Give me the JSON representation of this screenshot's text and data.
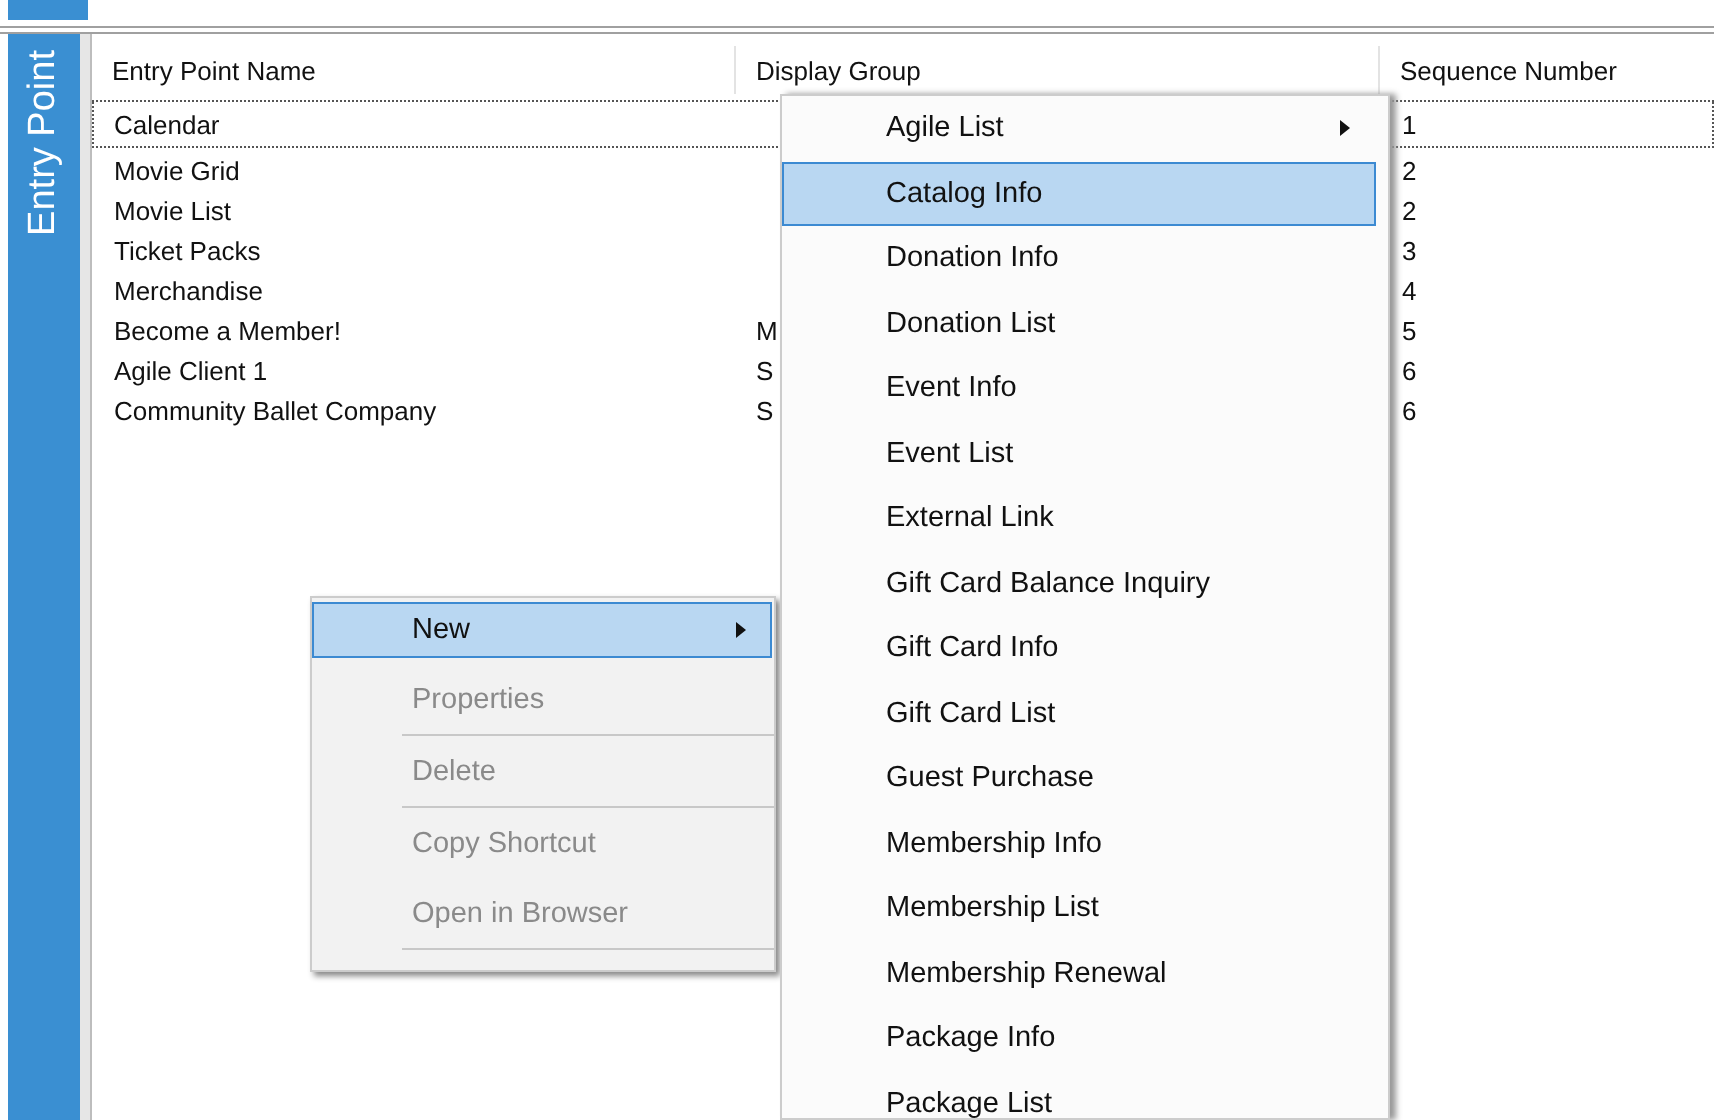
{
  "sidebar": {
    "title": "Entry Point"
  },
  "table": {
    "columns": [
      "Entry Point Name",
      "Display Group",
      "Sequence Number"
    ],
    "rows": [
      {
        "name": "Calendar",
        "display_group": "",
        "sequence": "1",
        "focused": true
      },
      {
        "name": "Movie Grid",
        "display_group": "",
        "sequence": "2",
        "focused": false
      },
      {
        "name": "Movie List",
        "display_group": "",
        "sequence": "2",
        "focused": false
      },
      {
        "name": "Ticket Packs",
        "display_group": "",
        "sequence": "3",
        "focused": false
      },
      {
        "name": "Merchandise",
        "display_group": "",
        "sequence": "4",
        "focused": false
      },
      {
        "name": "Become a Member!",
        "display_group": "M",
        "sequence": "5",
        "focused": false
      },
      {
        "name": "Agile Client 1",
        "display_group": "S",
        "sequence": "6",
        "focused": false
      },
      {
        "name": "Community Ballet Company",
        "display_group": "S",
        "sequence": "6",
        "focused": false
      }
    ]
  },
  "context_menu": {
    "items": [
      {
        "kind": "item",
        "label": "New",
        "selected": true,
        "disabled": false,
        "submenu": true
      },
      {
        "kind": "item",
        "label": "Properties",
        "selected": false,
        "disabled": true,
        "submenu": false
      },
      {
        "kind": "separator"
      },
      {
        "kind": "item",
        "label": "Delete",
        "selected": false,
        "disabled": true,
        "submenu": false
      },
      {
        "kind": "separator"
      },
      {
        "kind": "item",
        "label": "Copy Shortcut",
        "selected": false,
        "disabled": true,
        "submenu": false
      },
      {
        "kind": "item",
        "label": "Open in Browser",
        "selected": false,
        "disabled": true,
        "submenu": false
      },
      {
        "kind": "separator"
      }
    ]
  },
  "submenu": {
    "items": [
      {
        "label": "Agile List",
        "selected": false,
        "submenu": true
      },
      {
        "label": "Catalog Info",
        "selected": true,
        "submenu": false
      },
      {
        "label": "Donation Info",
        "selected": false,
        "submenu": false
      },
      {
        "label": "Donation List",
        "selected": false,
        "submenu": false
      },
      {
        "label": "Event Info",
        "selected": false,
        "submenu": false
      },
      {
        "label": "Event List",
        "selected": false,
        "submenu": false
      },
      {
        "label": "External Link",
        "selected": false,
        "submenu": false
      },
      {
        "label": "Gift Card Balance Inquiry",
        "selected": false,
        "submenu": false
      },
      {
        "label": "Gift Card Info",
        "selected": false,
        "submenu": false
      },
      {
        "label": "Gift Card List",
        "selected": false,
        "submenu": false
      },
      {
        "label": "Guest Purchase",
        "selected": false,
        "submenu": false
      },
      {
        "label": "Membership Info",
        "selected": false,
        "submenu": false
      },
      {
        "label": "Membership List",
        "selected": false,
        "submenu": false
      },
      {
        "label": "Membership Renewal",
        "selected": false,
        "submenu": false
      },
      {
        "label": "Package Info",
        "selected": false,
        "submenu": false
      },
      {
        "label": "Package List",
        "selected": false,
        "submenu": false
      }
    ]
  }
}
